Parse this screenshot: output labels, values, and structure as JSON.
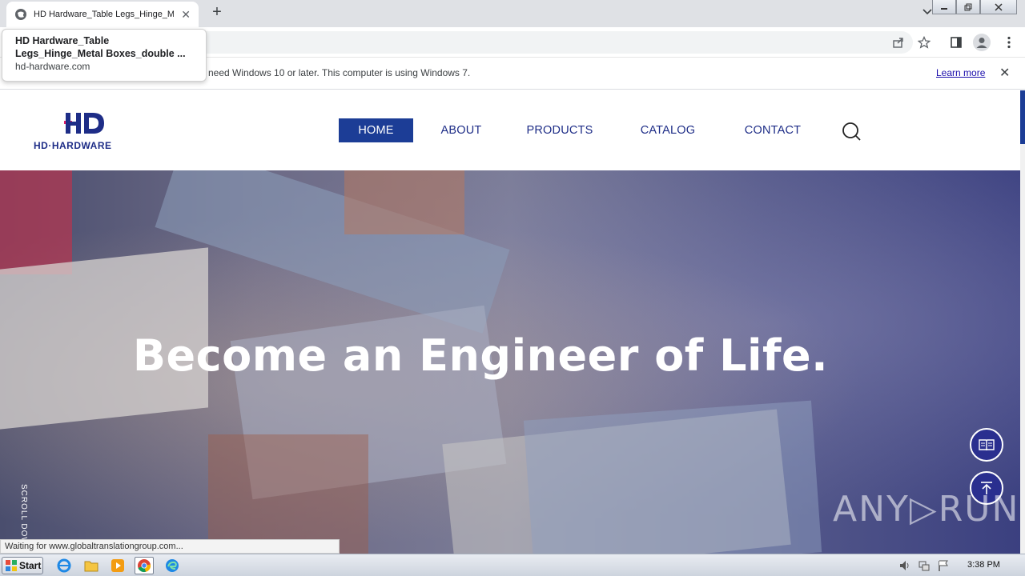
{
  "browser": {
    "tab_title": "HD Hardware_Table Legs_Hinge_Metal Boxes_double",
    "tab_close": "✕",
    "new_tab": "+",
    "hover_card": {
      "title": "HD Hardware_Table Legs_Hinge_Metal Boxes_double ...",
      "domain": "hd-hardware.com"
    },
    "infobar": {
      "message": "l need Windows 10 or later. This computer is using Windows 7.",
      "learn_more": "Learn more",
      "close": "✕"
    },
    "status_text": "Waiting for www.globaltranslationgroup.com..."
  },
  "site": {
    "logo_text": "HD·HARDWARE",
    "nav": [
      {
        "label": "HOME",
        "active": true
      },
      {
        "label": "ABOUT",
        "active": false
      },
      {
        "label": "PRODUCTS",
        "active": false
      },
      {
        "label": "CATALOG",
        "active": false
      },
      {
        "label": "CONTACT",
        "active": false
      }
    ],
    "hero_title": "Become an Engineer of Life.",
    "scroll_label": "SCROLL DOW"
  },
  "watermark": "ANY▷RUN",
  "taskbar": {
    "start_label": "Start",
    "clock": "3:38 PM"
  },
  "colors": {
    "brand_blue": "#1c3d96",
    "brand_pink": "#e0206a",
    "float_button": "#2a2f8f"
  }
}
